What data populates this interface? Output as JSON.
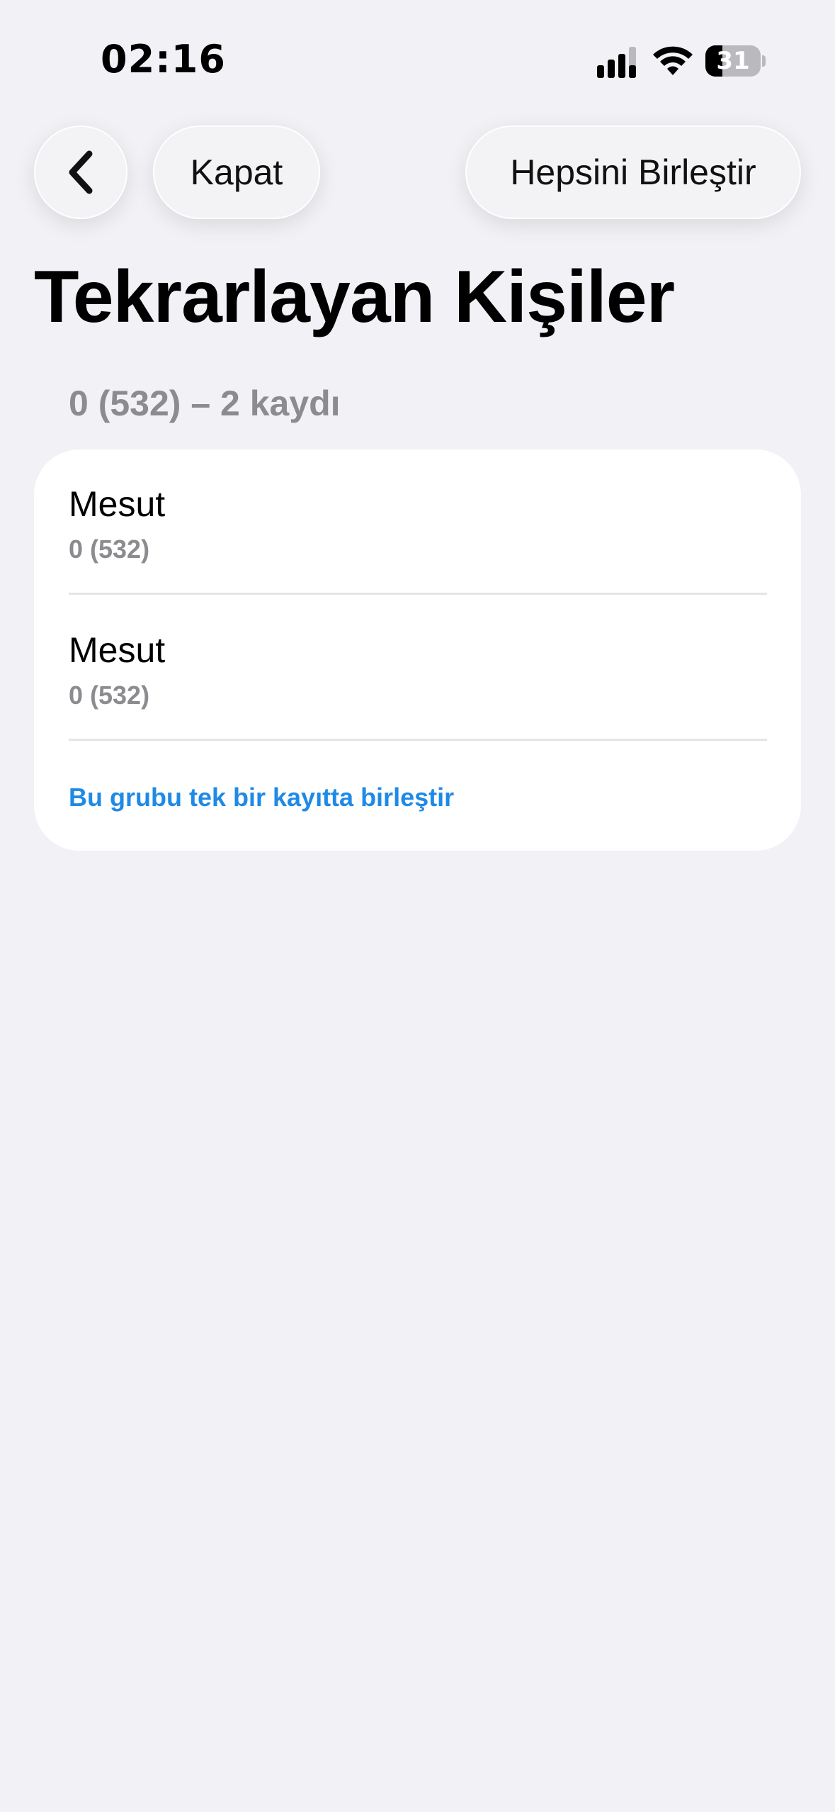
{
  "status_bar": {
    "time": "02:16",
    "battery_level": "31",
    "battery_fraction": 0.31,
    "icons": [
      "signal-icon",
      "wifi-icon",
      "battery-icon"
    ]
  },
  "nav": {
    "back_icon": "chevron-left-icon",
    "close_label": "Kapat",
    "merge_all_label": "Hepsini Birleştir"
  },
  "page": {
    "title": "Tekrarlayan Kişiler"
  },
  "group": {
    "header": "0 (532) – 2 kaydı",
    "records": [
      {
        "name": "Mesut",
        "phone": "0 (532)"
      },
      {
        "name": "Mesut",
        "phone": "0 (532)"
      }
    ],
    "merge_label": "Bu grubu tek bir kayıtta birleştir"
  },
  "colors": {
    "background": "#f1f1f6",
    "card": "#ffffff",
    "accent": "#1f8ae6",
    "secondary_text": "#8b8b90"
  }
}
